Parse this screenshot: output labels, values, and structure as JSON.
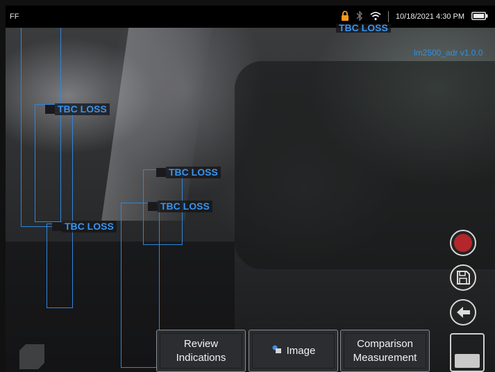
{
  "statusbar": {
    "left_text": "FF",
    "datetime": "10/18/2021 4:30 PM",
    "icons": [
      "lock-icon",
      "bluetooth-icon",
      "wifi-icon",
      "battery-icon"
    ]
  },
  "overlay": {
    "model_label": "lm2500_adr v1.0.0",
    "detections": [
      {
        "label": "TBC LOSS"
      },
      {
        "label": "TBC LOSS"
      },
      {
        "label": "TBC LOSS"
      },
      {
        "label": "TBC LOSS"
      },
      {
        "label": "TBC LOSS"
      }
    ]
  },
  "colors": {
    "detection_box": "#2e86de",
    "record_button": "#b3262b"
  },
  "buttons": {
    "review_line1": "Review",
    "review_line2": "Indications",
    "image_label": "Image",
    "comparison_line1": "Comparison",
    "comparison_line2": "Measurement"
  },
  "side_controls": [
    "record-icon",
    "save-icon",
    "back-arrow-icon"
  ]
}
